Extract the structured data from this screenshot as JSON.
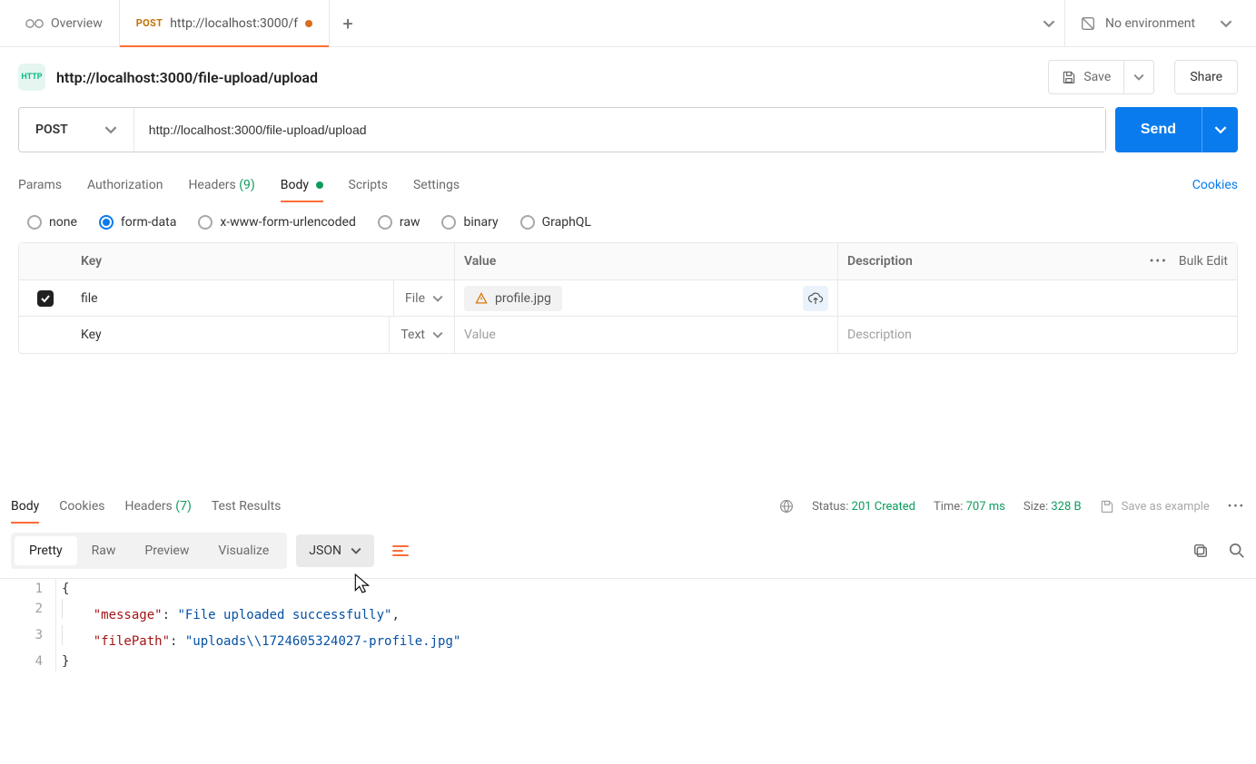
{
  "tabs": {
    "overview": "Overview",
    "requestMethod": "POST",
    "requestUrlShort": "http://localhost:3000/f",
    "environment": "No environment"
  },
  "request": {
    "title": "http://localhost:3000/file-upload/upload",
    "saveLabel": "Save",
    "shareLabel": "Share",
    "method": "POST",
    "url": "http://localhost:3000/file-upload/upload",
    "sendLabel": "Send"
  },
  "reqTabs": {
    "params": "Params",
    "auth": "Authorization",
    "headers": "Headers",
    "headersCount": "(9)",
    "body": "Body",
    "scripts": "Scripts",
    "settings": "Settings",
    "cookies": "Cookies"
  },
  "bodyTypes": {
    "none": "none",
    "formData": "form-data",
    "xwww": "x-www-form-urlencoded",
    "raw": "raw",
    "binary": "binary",
    "graphql": "GraphQL"
  },
  "formTable": {
    "headKey": "Key",
    "headValue": "Value",
    "headDesc": "Description",
    "bulkEdit": "Bulk Edit",
    "row1": {
      "key": "file",
      "type": "File",
      "fileName": "profile.jpg"
    },
    "placeholders": {
      "key": "Key",
      "value": "Value",
      "type": "Text",
      "desc": "Description"
    }
  },
  "respTabs": {
    "body": "Body",
    "cookies": "Cookies",
    "headers": "Headers",
    "headersCount": "(7)",
    "testResults": "Test Results"
  },
  "status": {
    "statusLabel": "Status:",
    "statusValue": "201 Created",
    "timeLabel": "Time:",
    "timeValue": "707 ms",
    "sizeLabel": "Size:",
    "sizeValue": "328 B",
    "saveExample": "Save as example"
  },
  "viewModes": {
    "pretty": "Pretty",
    "raw": "Raw",
    "preview": "Preview",
    "visualize": "Visualize",
    "format": "JSON"
  },
  "responseBody": {
    "line1": "{",
    "line2_key": "\"message\"",
    "line2_val": "\"File uploaded successfully\"",
    "line3_key": "\"filePath\"",
    "line3_val": "\"uploads\\\\1724605324027-profile.jpg\"",
    "line4": "}",
    "nums": {
      "n1": "1",
      "n2": "2",
      "n3": "3",
      "n4": "4"
    }
  }
}
